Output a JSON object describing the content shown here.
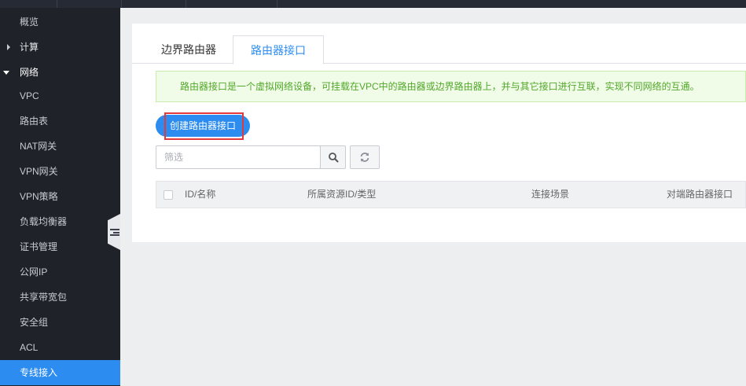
{
  "sidebar": {
    "items": [
      {
        "label": "概览"
      },
      {
        "label": "计算"
      },
      {
        "label": "网络"
      },
      {
        "label": "VPC"
      },
      {
        "label": "路由表"
      },
      {
        "label": "NAT网关"
      },
      {
        "label": "VPN网关"
      },
      {
        "label": "VPN策略"
      },
      {
        "label": "负载均衡器"
      },
      {
        "label": "证书管理"
      },
      {
        "label": "公网IP"
      },
      {
        "label": "共享带宽包"
      },
      {
        "label": "安全组"
      },
      {
        "label": "ACL"
      },
      {
        "label": "专线接入"
      }
    ],
    "active": "专线接入"
  },
  "tabs": [
    {
      "label": "边界路由器"
    },
    {
      "label": "路由器接口"
    }
  ],
  "active_tab": "路由器接口",
  "notice": "路由器接口是一个虚拟网络设备，可挂载在VPC中的路由器或边界路由器上，并与其它接口进行互联，实现不同网络的互通。",
  "create_button": "创建路由器接口",
  "filter": {
    "placeholder": "筛选",
    "value": ""
  },
  "table": {
    "columns": [
      "ID/名称",
      "所属资源ID/类型",
      "连接场景",
      "对端路由器接口"
    ]
  },
  "colors": {
    "accent": "#2d8cf0",
    "sidebar_bg": "#1f2329",
    "notice_text": "#52a829",
    "highlight": "#e23a3a"
  },
  "icons": {
    "search": "search-icon",
    "refresh": "refresh-icon",
    "collapse": "collapse-sidebar-icon"
  }
}
